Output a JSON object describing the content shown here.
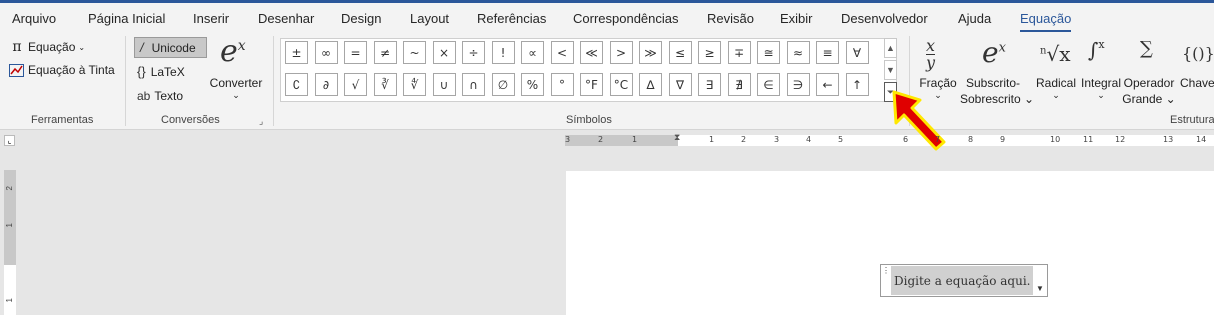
{
  "tabs": [
    {
      "label": "Arquivo",
      "active": false
    },
    {
      "label": "Página Inicial",
      "active": false
    },
    {
      "label": "Inserir",
      "active": false
    },
    {
      "label": "Desenhar",
      "active": false
    },
    {
      "label": "Design",
      "active": false
    },
    {
      "label": "Layout",
      "active": false
    },
    {
      "label": "Referências",
      "active": false
    },
    {
      "label": "Correspondências",
      "active": false
    },
    {
      "label": "Revisão",
      "active": false
    },
    {
      "label": "Exibir",
      "active": false
    },
    {
      "label": "Desenvolvedor",
      "active": false
    },
    {
      "label": "Ajuda",
      "active": false
    },
    {
      "label": "Equação",
      "active": true
    }
  ],
  "ferramentas": {
    "equation_label": "Equação",
    "ink_equation_label": "Equação à Tinta",
    "group_label": "Ferramentas"
  },
  "conversoes": {
    "unicode_label": "Unicode",
    "latex_label": "LaTeX",
    "text_label": "Texto",
    "convert_label": "Converter",
    "group_label": "Conversões"
  },
  "symbols": {
    "row1": [
      "±",
      "∞",
      "=",
      "≠",
      "~",
      "×",
      "÷",
      "!",
      "∝",
      "<",
      "≪",
      ">",
      "≫",
      "≤",
      "≥",
      "∓",
      "≅",
      "≈",
      "≡",
      "∀"
    ],
    "row2": [
      "∁",
      "∂",
      "√",
      "∛",
      "∜",
      "∪",
      "∩",
      "∅",
      "%",
      "°",
      "°F",
      "°C",
      "∆",
      "∇",
      "∃",
      "∄",
      "∈",
      "∋",
      "←",
      "↑"
    ],
    "group_label": "Símbolos"
  },
  "structures": {
    "items": [
      {
        "label": "Fração",
        "label2": ""
      },
      {
        "label": "Subscrito-",
        "label2": "Sobrescrito"
      },
      {
        "label": "Radical",
        "label2": ""
      },
      {
        "label": "Integral",
        "label2": ""
      },
      {
        "label": "Operador",
        "label2": "Grande"
      },
      {
        "label": "Chave",
        "label2": ""
      }
    ],
    "group_label": "Estrutura"
  },
  "ruler": {
    "numbers": [
      "3",
      "2",
      "1",
      "1",
      "2",
      "3",
      "4",
      "5",
      "6",
      "7",
      "8",
      "9",
      "10",
      "11",
      "12",
      "13",
      "14"
    ],
    "vertical_numbers": [
      "2",
      "1",
      "1"
    ]
  },
  "document": {
    "equation_placeholder": "Digite a equação aqui."
  },
  "colors": {
    "accent": "#2b579a",
    "arrow_fill": "#e00000",
    "arrow_outline": "#ffe800"
  }
}
